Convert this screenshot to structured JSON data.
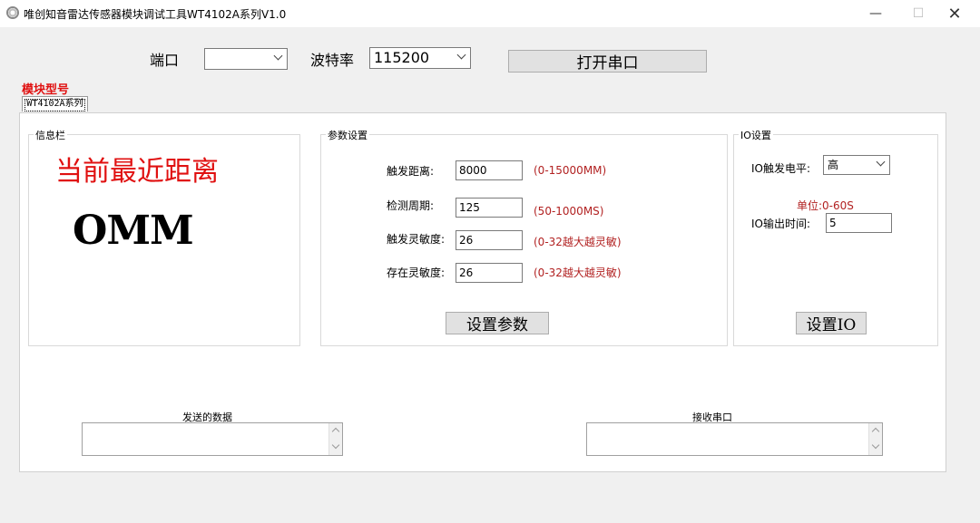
{
  "window": {
    "title": "唯创知音雷达传感器模块调试工具WT4102A系列V1.0",
    "minimize": "—",
    "maximize": "☐",
    "close": "✕"
  },
  "serial": {
    "port_label": "端口",
    "port_value": "",
    "baud_label": "波特率",
    "baud_value": "115200",
    "open_button": "打开串口"
  },
  "model": {
    "label": "模块型号",
    "tab": "WT4102A系列"
  },
  "info": {
    "title": "信息栏",
    "heading": "当前最近距离",
    "distance": "OMM"
  },
  "params": {
    "title": "参数设置",
    "rows": [
      {
        "label": "触发距离:",
        "value": "8000",
        "hint": "(0-15000MM)"
      },
      {
        "label": "检测周期:",
        "value": "125",
        "hint": "(50-1000MS)"
      },
      {
        "label": "触发灵敏度:",
        "value": "26",
        "hint": "(0-32越大越灵敏)"
      },
      {
        "label": "存在灵敏度:",
        "value": "26",
        "hint": "(0-32越大越灵敏)"
      }
    ],
    "set_button": "设置参数"
  },
  "io": {
    "title": "IO设置",
    "level_label": "IO触发电平:",
    "level_value": "高",
    "unit_hint": "单位:0-60S",
    "time_label": "IO输出时间:",
    "time_value": "5",
    "set_button": "设置IO"
  },
  "send": {
    "label": "发送的数据",
    "value": ""
  },
  "recv": {
    "label": "接收串口",
    "value": ""
  },
  "colors": {
    "accent_red": "#e01010",
    "hint_red": "#b22222"
  }
}
